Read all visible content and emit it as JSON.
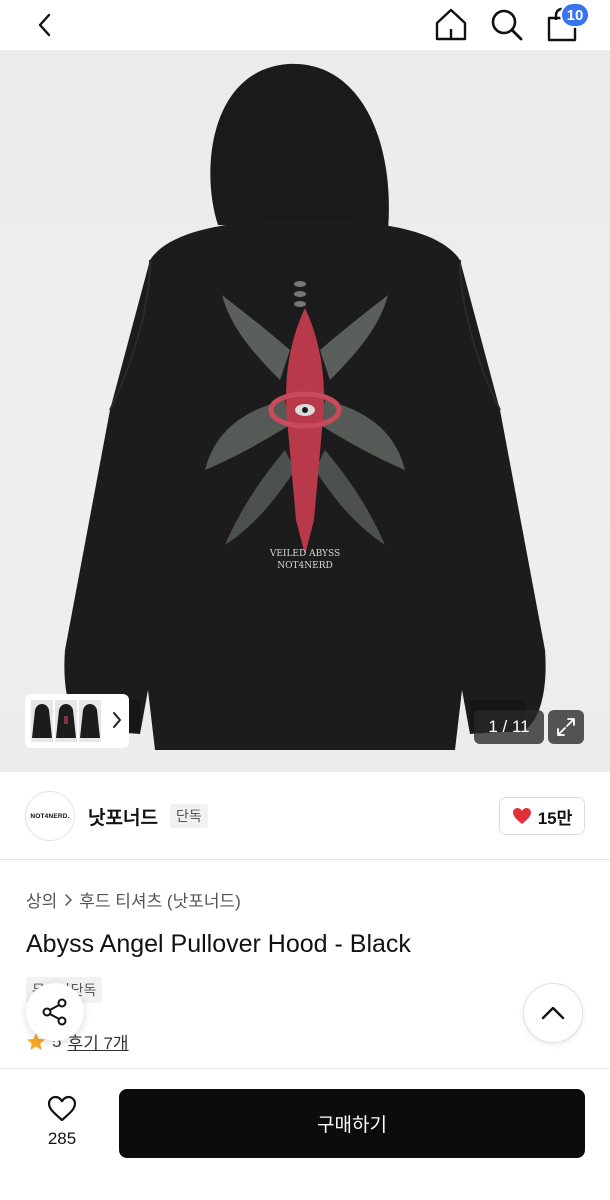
{
  "cart": {
    "count": "10"
  },
  "gallery": {
    "counter": "1 / 11",
    "print_line1": "VEILED ABYSS",
    "print_line2": "NOT4NERD"
  },
  "brand": {
    "logo_text": "NOT4NERD.",
    "name": "낫포너드",
    "tag": "단독",
    "likes": "15만"
  },
  "product": {
    "breadcrumb": [
      "상의",
      "후드 티셔츠 (낫포너드)"
    ],
    "title": "Abyss Angel Pullover Hood - Black",
    "tags": [
      "무신사단독"
    ],
    "rating_score": "5",
    "reviews": "후기 7개"
  },
  "bottom": {
    "wish_count": "285",
    "buy_label": "구매하기"
  },
  "colors": {
    "accent": "#3a73f0",
    "heart": "#e0303a",
    "buy_bg": "#0c0c0c",
    "star": "#f5a623"
  }
}
